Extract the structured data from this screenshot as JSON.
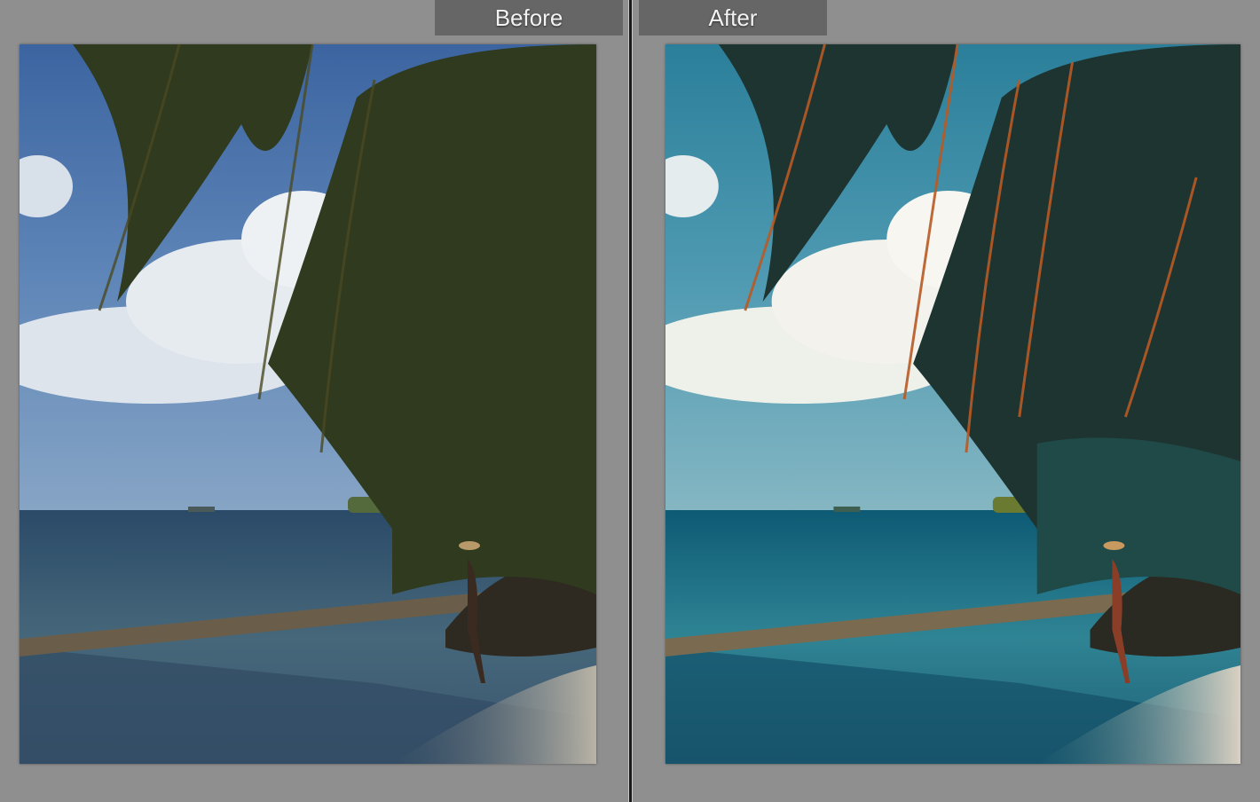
{
  "compare_view": {
    "before": {
      "label": "Before"
    },
    "after": {
      "label": "After"
    }
  },
  "colors": {
    "workspace_bg": "#8f8f8f",
    "label_bg": "#666666",
    "label_text": "#f2f2f2"
  }
}
